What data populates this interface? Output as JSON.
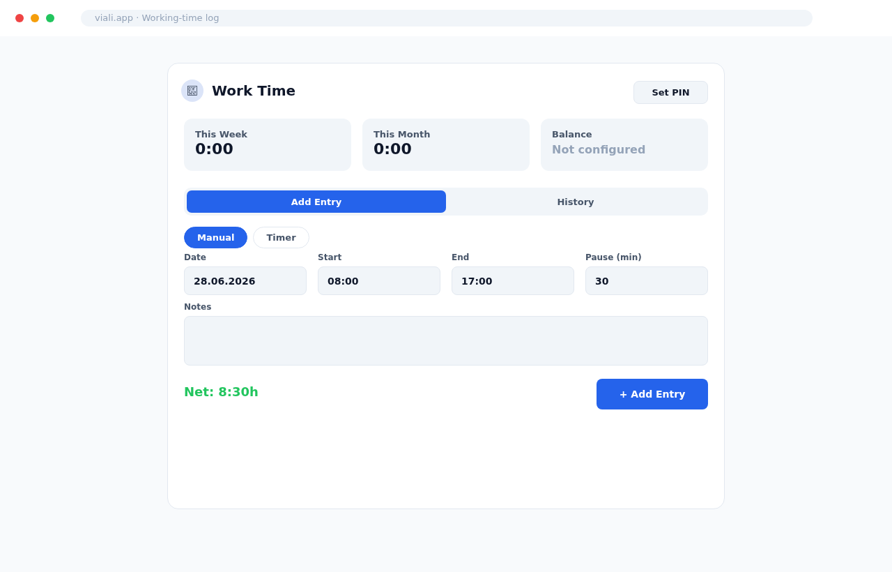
{
  "browser": {
    "address": "viali.app · Working-time log"
  },
  "header": {
    "title": "Work Time",
    "pin_button": "Set PIN"
  },
  "stats": [
    {
      "label": "This Week",
      "value": "0:00",
      "kind": "value"
    },
    {
      "label": "This Month",
      "value": "0:00",
      "kind": "value"
    },
    {
      "label": "Balance",
      "value": "Not configured",
      "kind": "muted"
    }
  ],
  "tabs": [
    {
      "label": "Add Entry",
      "selected": true
    },
    {
      "label": "History",
      "selected": false
    }
  ],
  "modes": [
    {
      "label": "Manual",
      "selected": true
    },
    {
      "label": "Timer",
      "selected": false
    }
  ],
  "fields": [
    {
      "label": "Date",
      "value": "28.06.2026"
    },
    {
      "label": "Start",
      "value": "08:00"
    },
    {
      "label": "End",
      "value": "17:00"
    },
    {
      "label": "Pause (min)",
      "value": "30"
    }
  ],
  "notes": {
    "label": "Notes"
  },
  "footer": {
    "net": "Net: 8:30h",
    "submit_button": "+ Add Entry"
  }
}
